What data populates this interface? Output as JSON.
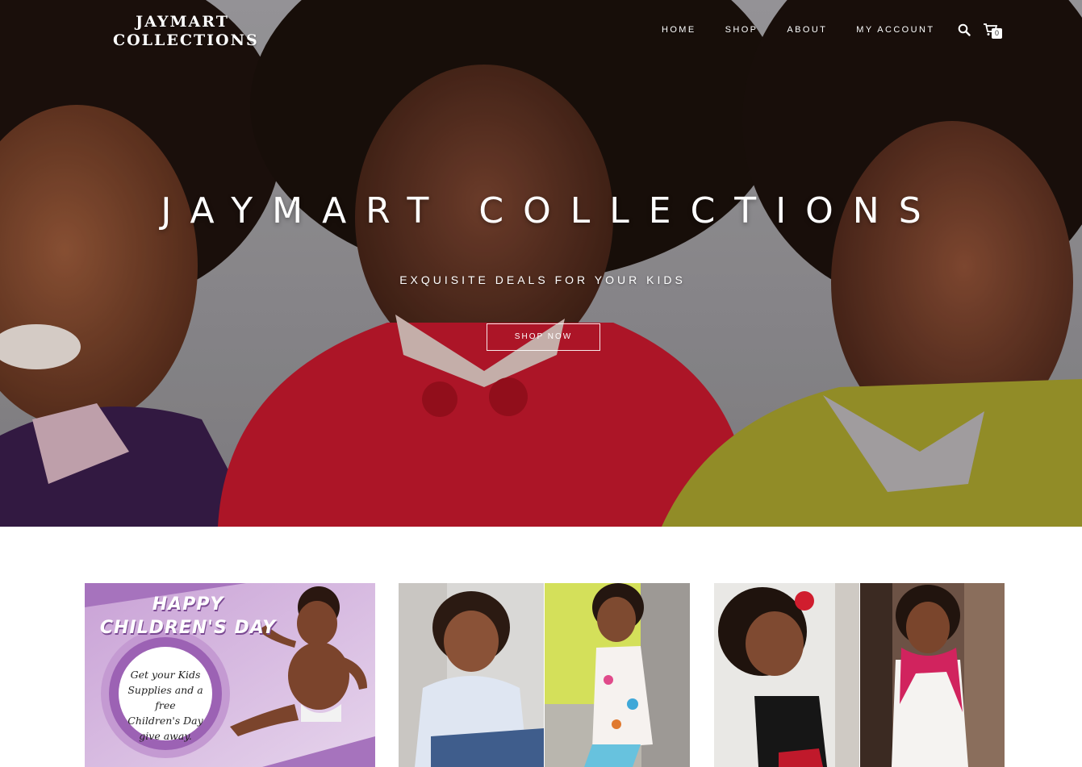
{
  "header": {
    "logo_line1": "JAYMART",
    "logo_line2": "COLLECTIONS",
    "nav": [
      "HOME",
      "SHOP",
      "ABOUT",
      "MY ACCOUNT"
    ],
    "cart_count": "0",
    "icons": [
      "search-icon",
      "cart-icon"
    ]
  },
  "hero": {
    "title": "JAYMART COLLECTIONS",
    "subtitle": "EXQUISITE DEALS FOR YOUR KIDS",
    "cta_label": "SHOP NOW"
  },
  "banners": {
    "promo": {
      "title_line1": "HAPPY",
      "title_line2": "CHILDREN'S DAY",
      "text_line1": "Get your Kids",
      "text_line2": "Supplies and a free",
      "text_line3": "Children's Day",
      "text_line4": "give away."
    }
  },
  "colors": {
    "accent_purple": "#a673bd",
    "white": "#ffffff"
  }
}
